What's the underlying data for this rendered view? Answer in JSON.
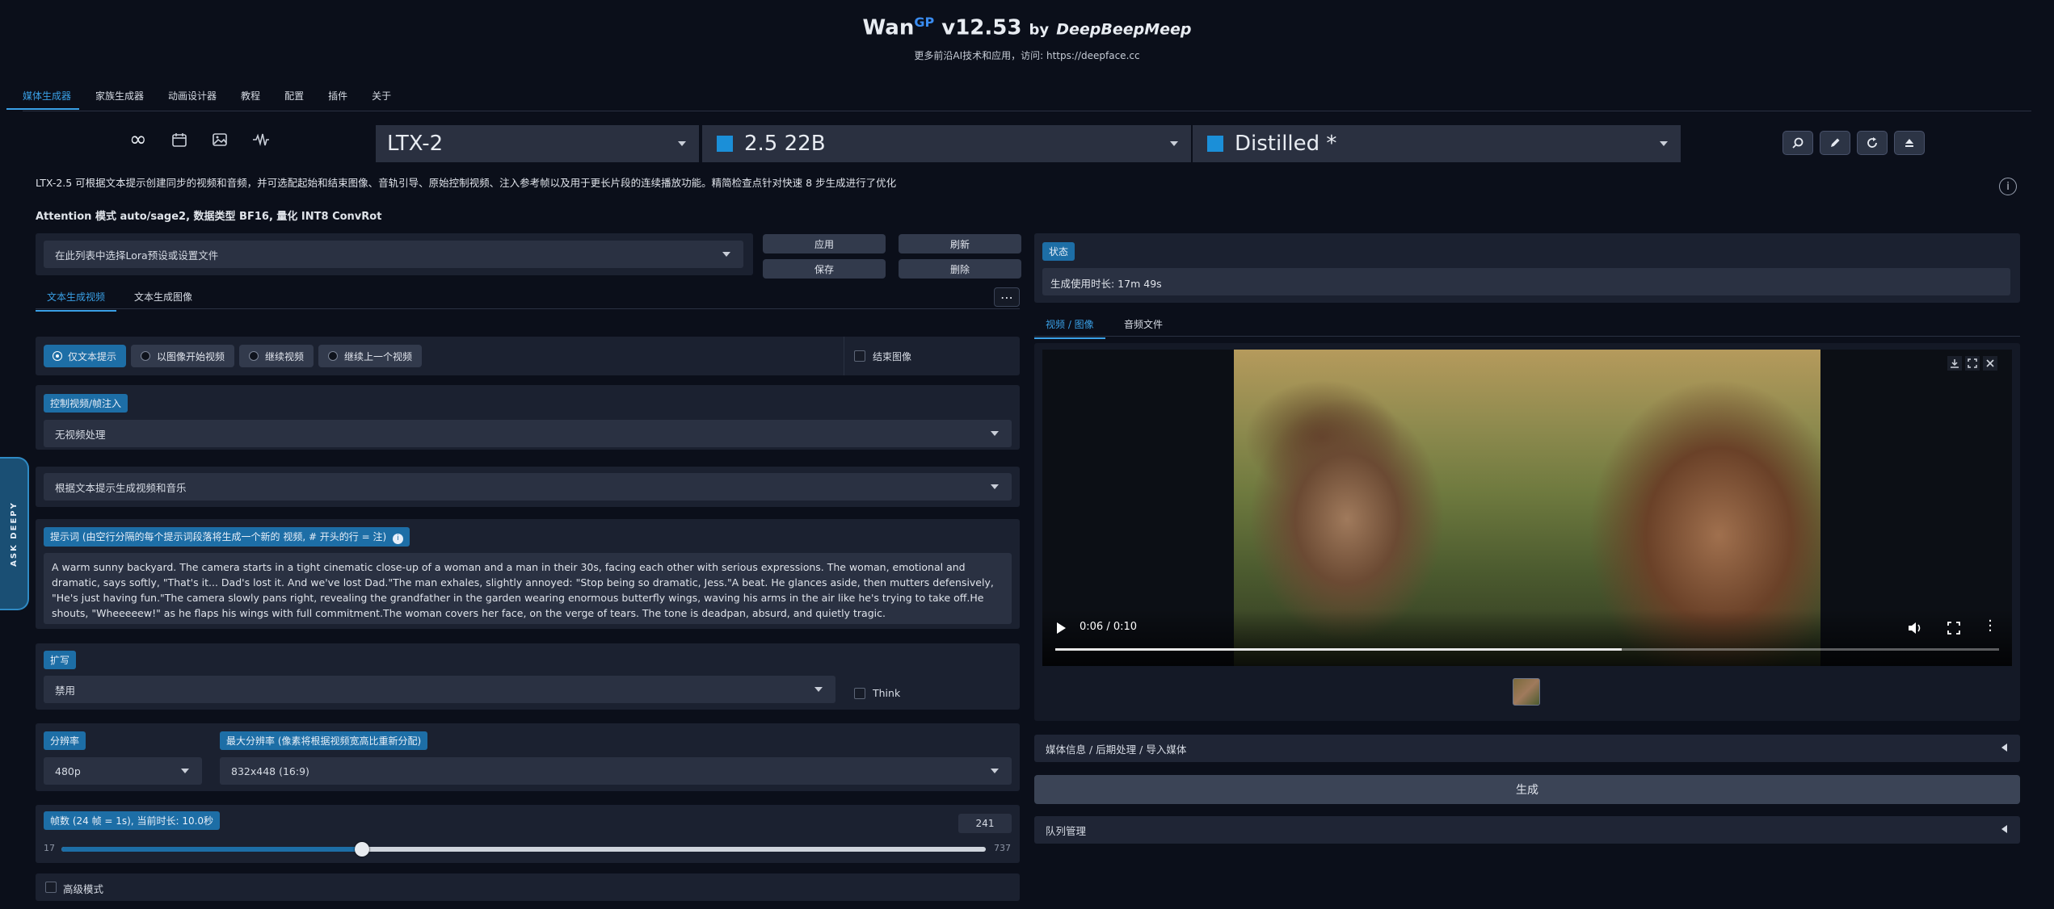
{
  "header": {
    "title": "Wan",
    "title_sup": "GP",
    "version": "v12.53",
    "by": "by",
    "author": "DeepBeepMeep",
    "subtitle": "更多前沿AI技术和应用，访问: https://deepface.cc"
  },
  "nav_tabs": [
    "媒体生成器",
    "家族生成器",
    "动画设计器",
    "教程",
    "配置",
    "插件",
    "关于"
  ],
  "mode_icons": [
    "infinity-icon",
    "calendar-icon",
    "image-icon",
    "audio-wave-icon"
  ],
  "model_selects": {
    "family": "LTX-2",
    "version": "2.5 22B",
    "variant": "Distilled *"
  },
  "description": "LTX-2.5 可根据文本提示创建同步的视频和音频，并可选配起始和结束图像、音轨引导、原始控制视频、注入参考帧以及用于更长片段的连续播放功能。精简检查点针对快速 8 步生成进行了优化",
  "attention": "Attention 模式 auto/sage2, 数据类型 BF16, 量化 INT8 ConvRot",
  "lora": {
    "placeholder": "在此列表中选择Lora预设或设置文件",
    "apply": "应用",
    "refresh": "刷新",
    "save": "保存",
    "delete": "删除"
  },
  "gen_tabs": [
    "文本生成视频",
    "文本生成图像"
  ],
  "more_dots": "⋯",
  "start_options": [
    "仅文本提示",
    "以图像开始视频",
    "继续视频",
    "继续上一个视频"
  ],
  "end_image_label": "结束图像",
  "control": {
    "label": "控制视频/帧注入",
    "value": "无视频处理"
  },
  "prompt_mode": "根据文本提示生成视频和音乐",
  "prompt": {
    "label": "提示词 (由空行分隔的每个提示词段落将生成一个新的 视频, # 开头的行 = 注)",
    "text": "A warm sunny backyard. The camera starts in a tight cinematic close-up of a woman and a man in their 30s, facing each other with serious expressions. The woman, emotional and dramatic, says softly, \"That's it... Dad's lost it. And we've lost Dad.\"The man exhales, slightly annoyed: \"Stop being so dramatic, Jess.\"A beat. He glances aside, then mutters defensively, \"He's just having fun.\"The camera slowly pans right, revealing the grandfather in the garden wearing enormous butterfly wings, waving his arms in the air like he's trying to take off.He shouts, \"Wheeeeew!\" as he flaps his wings with full commitment.The woman covers her face, on the verge of tears. The tone is deadpan, absurd, and quietly tragic."
  },
  "enhancer": {
    "label": "扩写",
    "value": "禁用",
    "think_label": "Think"
  },
  "resolution": {
    "label": "分辨率",
    "value": "480p",
    "max_label": "最大分辨率 (像素将根据视频宽高比重新分配)",
    "max_value": "832x448 (16:9)"
  },
  "frames": {
    "label": "帧数 (24 帧 = 1s), 当前时长: 10.0秒",
    "value": 241,
    "value_text": "241",
    "min": "17",
    "max": "737",
    "fill_fraction": 0.325
  },
  "advanced_label": "高级模式",
  "side_tab": "ASK DEEPY",
  "status": {
    "label": "状态",
    "text": "生成使用时长: 17m 49s"
  },
  "output_tabs": [
    "视频 / 图像",
    "音频文件"
  ],
  "video": {
    "time": "0:06 / 0:10",
    "progress": 0.6
  },
  "media_info": "媒体信息 / 后期处理 / 导入媒体",
  "generate": "生成",
  "queue": "队列管理",
  "colors": {
    "accent": "#1d6ea6",
    "selected_tab": "#3aa0e6",
    "background": "#0b0f1a",
    "panel": "#1b2130"
  }
}
